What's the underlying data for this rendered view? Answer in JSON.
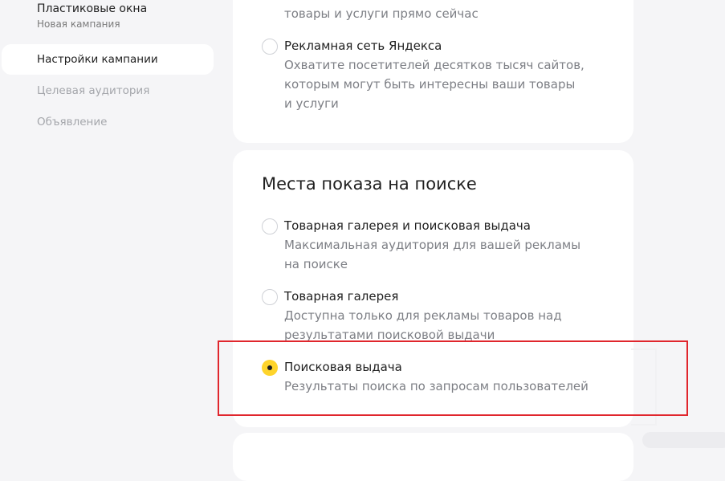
{
  "sidebar": {
    "campaign_name": "Пластиковые окна",
    "campaign_subtitle": "Новая кампания",
    "nav": [
      {
        "label": "Настройки кампании",
        "active": true
      },
      {
        "label": "Целевая аудитория",
        "active": false
      },
      {
        "label": "Объявление",
        "active": false
      }
    ]
  },
  "top_card": {
    "partial_option": {
      "desc_visible_line": "товары и услуги прямо сейчас"
    },
    "option_ad_network": {
      "title": "Рекламная сеть Яндекса",
      "desc_lines": [
        "Охватите посетителей десятков тысяч сайтов,",
        "которым могут быть интересны ваши товары",
        "и услуги"
      ],
      "selected": false
    }
  },
  "places_card": {
    "title": "Места показа на поиске",
    "options": [
      {
        "title": "Товарная галерея и поисковая выдача",
        "desc_lines": [
          "Максимальная аудитория для вашей рекламы",
          "на поиске"
        ],
        "selected": false
      },
      {
        "title": "Товарная галерея",
        "desc_lines": [
          "Доступна только для рекламы товаров над",
          "результатами поисковой выдачи"
        ],
        "selected": false
      },
      {
        "title": "Поисковая выдача",
        "desc_lines": [
          "Результаты поиска по запросам пользователей"
        ],
        "selected": true
      }
    ]
  },
  "colors": {
    "accent": "#fed42b",
    "highlight": "#e0262d",
    "background": "#f5f5f7"
  }
}
